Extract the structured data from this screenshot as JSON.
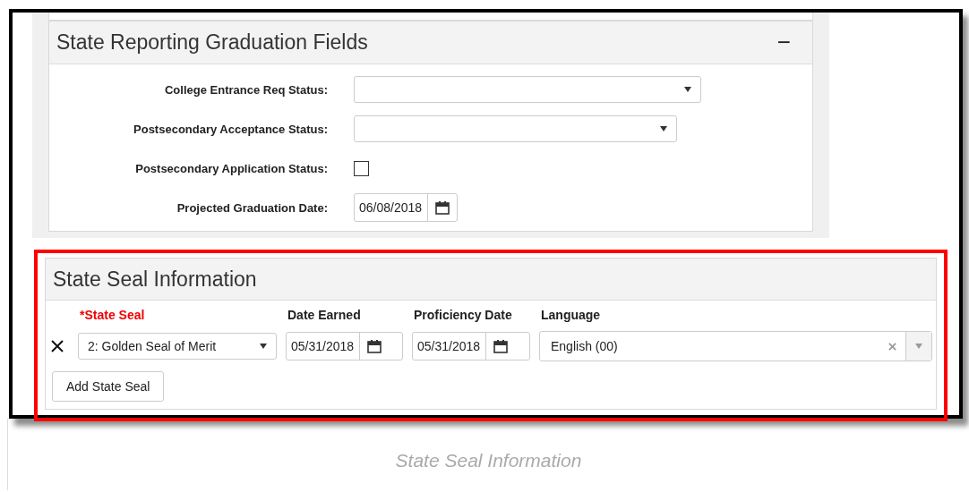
{
  "graduation_section": {
    "title": "State Reporting Graduation Fields",
    "collapse_symbol": "−",
    "fields": [
      {
        "kind": "select",
        "label": "College Entrance Req Status:"
      },
      {
        "kind": "select",
        "label": "Postsecondary Acceptance Status:"
      },
      {
        "kind": "checkbox",
        "label": "Postsecondary Application Status:",
        "checked": false
      },
      {
        "kind": "date",
        "label": "Projected Graduation Date:",
        "value": "06/08/2018"
      }
    ]
  },
  "seal_section": {
    "title": "State Seal Information",
    "columns": [
      {
        "label": "*State Seal",
        "required": true
      },
      {
        "label": "Date Earned",
        "required": false
      },
      {
        "label": "Proficiency Date",
        "required": false
      },
      {
        "label": "Language",
        "required": false
      }
    ],
    "rows": [
      {
        "state_seal": "2: Golden Seal of Merit",
        "date_earned": "05/31/2018",
        "proficiency_date": "05/31/2018",
        "language": "English (00)"
      }
    ],
    "add_button": "Add State Seal"
  },
  "caption": "State Seal Information"
}
